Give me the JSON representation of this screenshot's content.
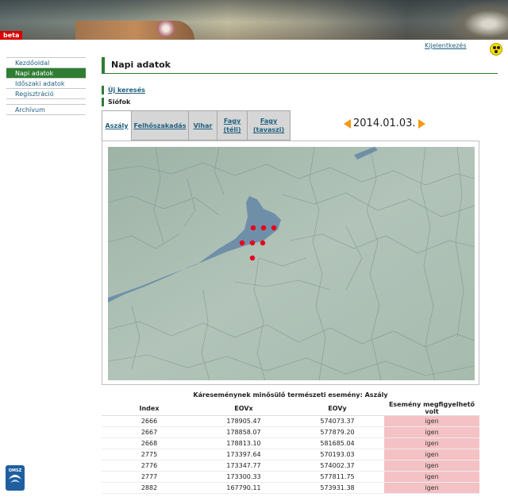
{
  "header": {
    "beta_label": "beta",
    "logout_label": "Kijelentkezés"
  },
  "sidebar": {
    "items": [
      {
        "label": "Kezdőoldal",
        "active": false
      },
      {
        "label": "Napi adatok",
        "active": true
      },
      {
        "label": "Időszaki adatok",
        "active": false
      },
      {
        "label": "Regisztráció",
        "active": false
      }
    ],
    "archive_label": "Archívum"
  },
  "main": {
    "title": "Napi adatok",
    "new_search_label": "Új keresés",
    "location": "Siófok",
    "tabs": [
      {
        "label": "Aszály",
        "active": true
      },
      {
        "label": "Felhőszakadás",
        "active": false
      },
      {
        "label": "Vihar",
        "active": false
      },
      {
        "label": "Fagy (téli)",
        "active": false
      },
      {
        "label": "Fagy (tavaszi)",
        "active": false
      }
    ],
    "date": "2014.01.03."
  },
  "table": {
    "caption": "Káreseménynek minősülő természeti esemény: Aszály",
    "headers": [
      "Index",
      "EOVx",
      "EOVy",
      "Esemény megfigyelhető volt"
    ],
    "rows": [
      {
        "index": "2666",
        "eovx": "178905.47",
        "eovy": "574073.37",
        "observed": "igen"
      },
      {
        "index": "2667",
        "eovx": "178858.07",
        "eovy": "577879.20",
        "observed": "igen"
      },
      {
        "index": "2668",
        "eovx": "178813.10",
        "eovy": "581685.04",
        "observed": "igen"
      },
      {
        "index": "2775",
        "eovx": "173397.64",
        "eovy": "570193.03",
        "observed": "igen"
      },
      {
        "index": "2776",
        "eovx": "173347.77",
        "eovy": "574002.37",
        "observed": "igen"
      },
      {
        "index": "2777",
        "eovx": "173300.33",
        "eovy": "577811.75",
        "observed": "igen"
      },
      {
        "index": "2882",
        "eovx": "167790.11",
        "eovy": "573931.38",
        "observed": "igen"
      }
    ]
  },
  "logo": {
    "text": "OMSZ"
  },
  "colors": {
    "accent_green": "#2e7d32",
    "link_blue": "#1f5f7f",
    "highlight_pink": "#f4c1c4",
    "map_land": "#a9bdb3",
    "map_water": "#6f8fa9",
    "marker_red": "#e8001c",
    "date_arrow_orange": "#f29a1a"
  },
  "icons": {
    "accessibility": "accessibility-icon",
    "prev_date": "arrow-left-icon",
    "next_date": "arrow-right-icon"
  }
}
